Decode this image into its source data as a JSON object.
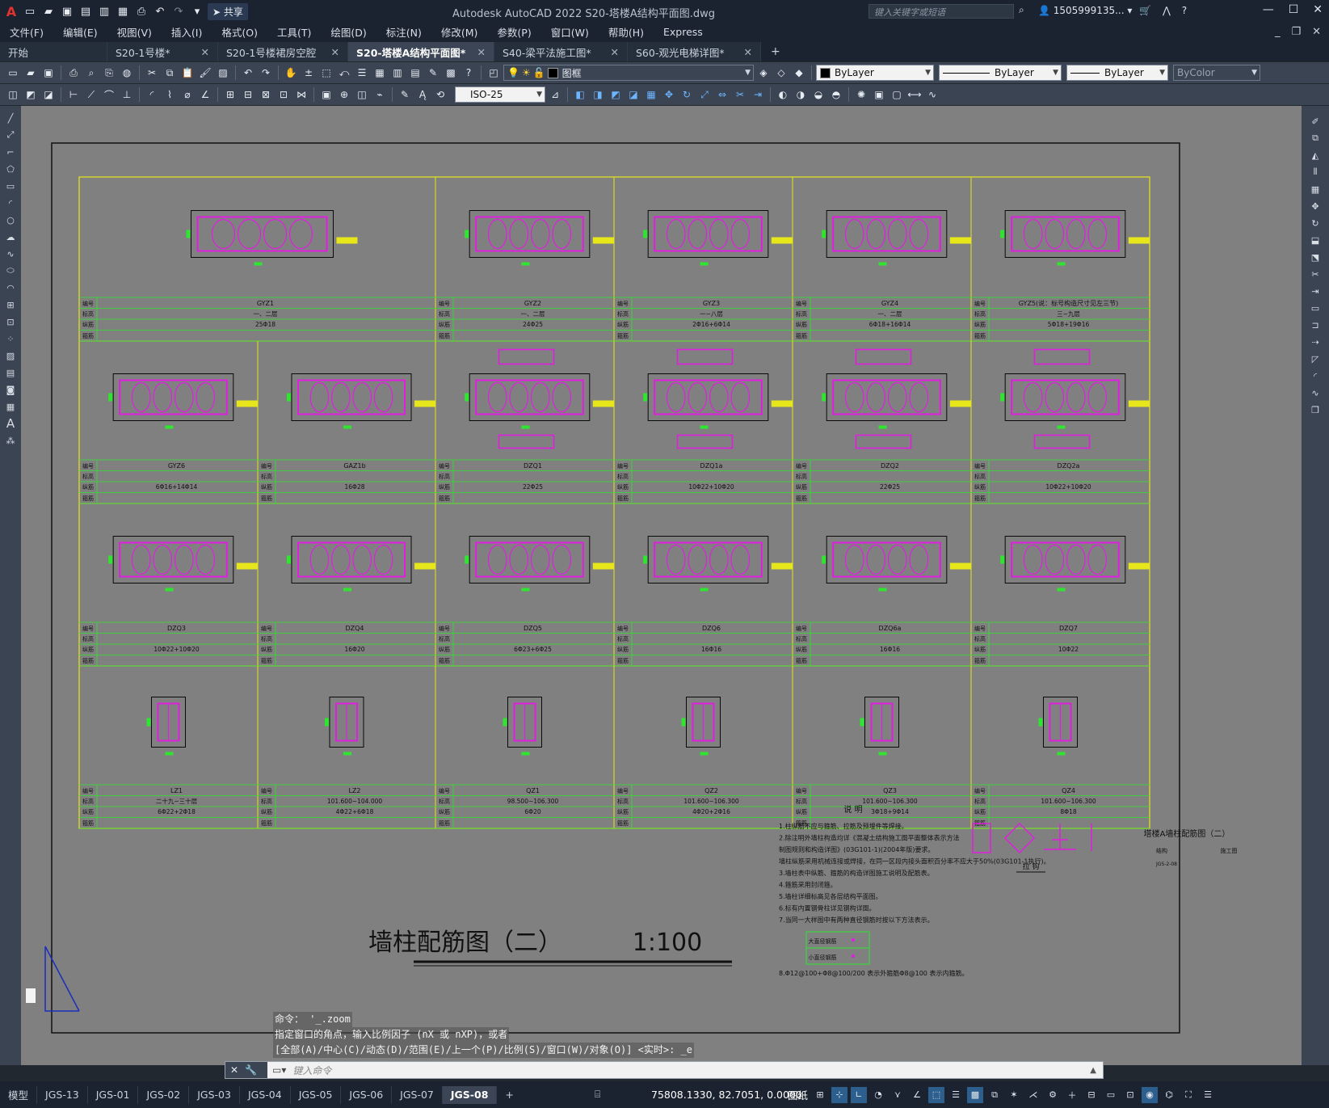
{
  "app": {
    "logo": "A",
    "title": "Autodesk AutoCAD 2022    S20-塔楼A结构平面图.dwg",
    "share_label": "共享",
    "search_placeholder": "键入关键字或短语",
    "user": "1505999135...",
    "quick_access_icons": [
      "new-icon",
      "open-icon",
      "save-icon",
      "saveas-icon",
      "web-open-icon",
      "web-save-icon",
      "plot-icon",
      "undo-icon",
      "redo-icon",
      "customize-icon"
    ]
  },
  "menu": {
    "items": [
      "文件(F)",
      "编辑(E)",
      "视图(V)",
      "插入(I)",
      "格式(O)",
      "工具(T)",
      "绘图(D)",
      "标注(N)",
      "修改(M)",
      "参数(P)",
      "窗口(W)",
      "帮助(H)",
      "Express"
    ]
  },
  "tabs": [
    {
      "label": "开始",
      "closable": false,
      "active": false
    },
    {
      "label": "S20-1号楼*",
      "closable": true,
      "active": false
    },
    {
      "label": "S20-1号楼裙房空腔",
      "closable": true,
      "active": false
    },
    {
      "label": "S20-塔楼A结构平面图*",
      "closable": true,
      "active": true
    },
    {
      "label": "S40-梁平法施工图*",
      "closable": true,
      "active": false
    },
    {
      "label": "S60-观光电梯详图*",
      "closable": true,
      "active": false
    }
  ],
  "toolbar": {
    "layer_value": "图框",
    "color_value": "ByLayer",
    "linetype_value": "ByLayer",
    "lineweight_value": "ByLayer",
    "plotstyle_value": "ByColor",
    "dimstyle_value": "ISO-25"
  },
  "drawing": {
    "title": "墙柱配筋图（二）",
    "scale": "1:100",
    "row1": [
      "GYZ1",
      "GYZ2",
      "GYZ3",
      "GYZ4",
      "GYZ5(说：标号构造尺寸见左三节)"
    ],
    "row2": [
      "GYZ6",
      "GAZ1b",
      "DZQ1",
      "DZQ1a",
      "DZQ2",
      "DZQ2a"
    ],
    "row3": [
      "DZQ3",
      "DZQ4",
      "DZQ5",
      "DZQ6",
      "DZQ6a",
      "DZQ7"
    ],
    "row4": [
      "LZ1",
      "LZ2",
      "QZ1",
      "QZ2",
      "QZ3",
      "QZ4"
    ],
    "row1_rebar": [
      "25Φ18",
      "24Φ25",
      "2Φ16+6Φ14",
      "6Φ18+16Φ14",
      "5Φ18+19Φ16"
    ],
    "row2_rebar": [
      "6Φ16+14Φ14",
      "16Φ28",
      "22Φ25",
      "10Φ22+10Φ20",
      "22Φ25",
      "10Φ22+10Φ20"
    ],
    "row3_rebar": [
      "10Φ22+10Φ20",
      "16Φ20",
      "6Φ23+6Φ25",
      "16Φ16",
      "16Φ16",
      "10Φ22"
    ],
    "row4_rebar": [
      "6Φ22+2Φ18",
      "4Φ22+6Φ18",
      "6Φ20",
      "4Φ20+2Φ16",
      "3Φ18+9Φ14",
      "8Φ18"
    ],
    "row1_level": [
      "一、二层",
      "一、二层",
      "一~八层",
      "一、二层",
      "三~九层"
    ],
    "row4_level": [
      "二十九~三十层",
      "101.600~104.000",
      "98.500~106.300",
      "101.600~106.300",
      "101.600~106.300",
      "101.600~106.300"
    ],
    "notes_title": "说  明",
    "notes": [
      "1.柱纵筋不应与箍筋、拉筋及预埋件等焊接。",
      "2.除注明外墙柱构造均详《混凝土结构施工图平面整体表示方法",
      "  制图规则和构造详图》(03G101-1)(2004年版)要求。",
      "  墙柱纵筋采用机械连接或焊接，在同一区段内接头面积百分率不应大于50%(03G101-1执行)。",
      "3.墙柱表中纵筋、箍筋的构造详图施工说明及配筋表。",
      "4.箍筋采用封闭箍。",
      "5.墙柱详细标高见各层结构平面图。",
      "6.标有内置钢骨柱详见钢构详图。",
      "7.当同一大样图中有两种直径钢筋时按以下方法表示。"
    ],
    "legend_big": "大直径钢筋",
    "legend_small": "小直径钢筋",
    "note8": "8.Φ12@100+Φ8@100/200 表示外箍筋Φ8@100 表示内箍筋。",
    "example_label": "拉  钩",
    "sheet_title": "塔楼A墙柱配筋图（二）",
    "sheet_sub1": "结构",
    "sheet_sub2": "施工图",
    "sheet_no": "JGS-2-08"
  },
  "command": {
    "history": [
      "命令： '_.zoom",
      "指定窗口的角点，输入比例因子 (nX 或 nXP)，或者",
      "[全部(A)/中心(C)/动态(D)/范围(E)/上一个(P)/比例(S)/窗口(W)/对象(O)] <实时>: _e"
    ],
    "placeholder": "键入命令"
  },
  "status": {
    "layouts": [
      "模型",
      "JGS-13",
      "JGS-01",
      "JGS-02",
      "JGS-03",
      "JGS-04",
      "JGS-05",
      "JGS-06",
      "JGS-07",
      "JGS-08"
    ],
    "active_layout": "JGS-08",
    "coords": "75808.1330, 82.7051, 0.0000",
    "space": "图纸"
  },
  "colors": {
    "canvas": "#808080",
    "grid_yellow": "#e6e61a",
    "grid_green": "#2ee62e",
    "rebar_magenta": "#e01ee0",
    "line_black": "#0a0a0a",
    "accent_blue": "#2d5f8e"
  }
}
